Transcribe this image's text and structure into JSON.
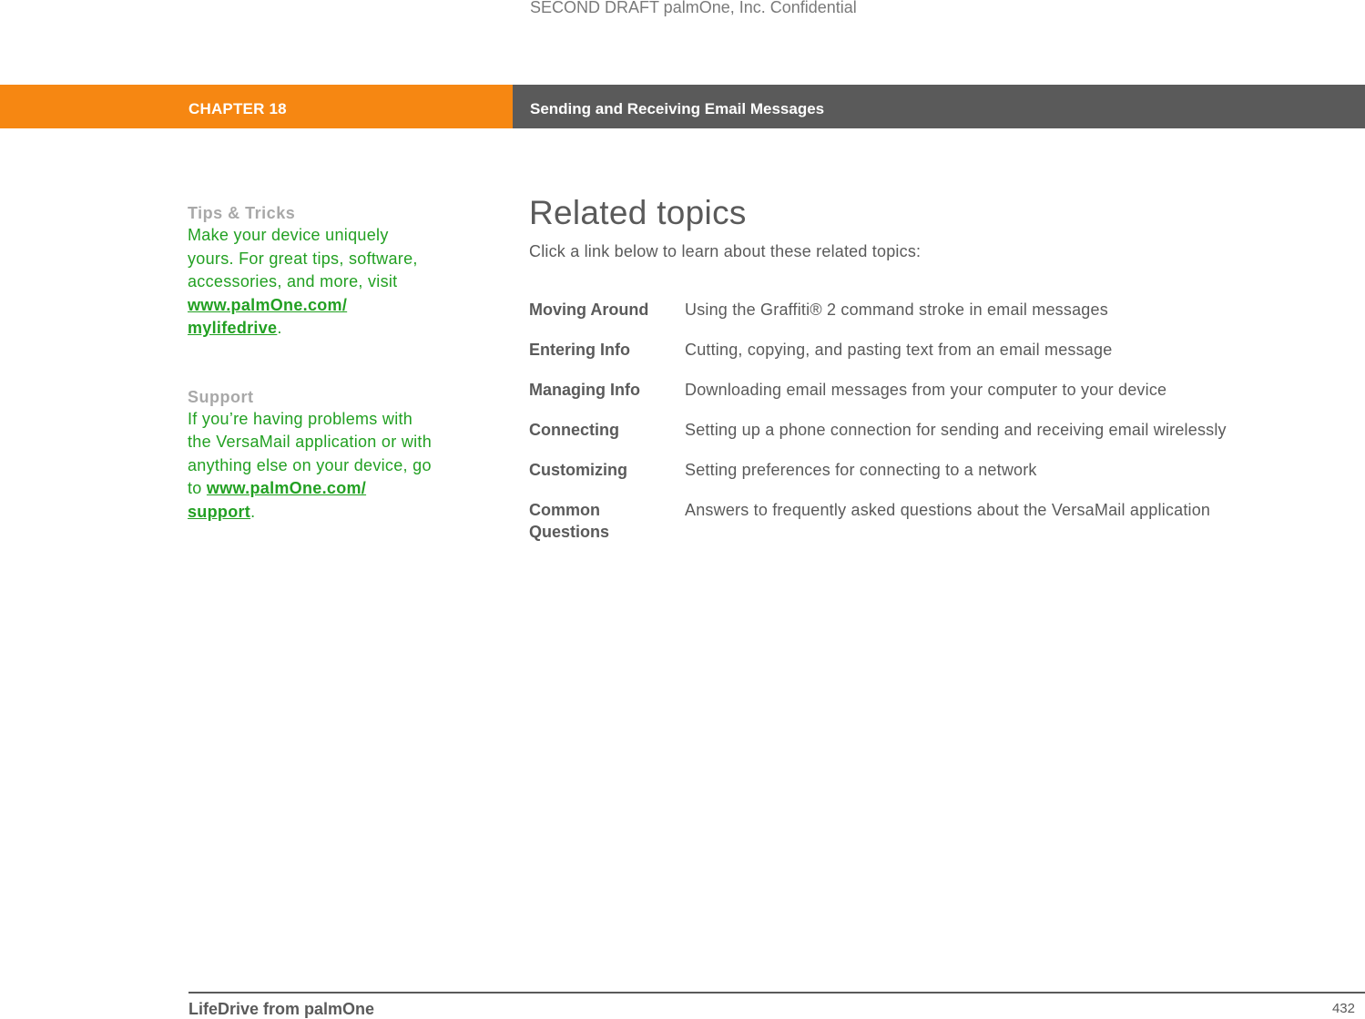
{
  "watermark": "SECOND DRAFT palmOne, Inc.  Confidential",
  "header": {
    "chapter": "CHAPTER 18",
    "title": "Sending and Receiving Email Messages",
    "chapter_color": "#f68712",
    "title_bar_color": "#5a5a5a"
  },
  "sidebar": {
    "tips": {
      "heading": "Tips & Tricks",
      "text": "Make your device uniquely yours. For great tips, software, accessories, and more, visit ",
      "link": "www.palmOne.com/ mylifedrive",
      "suffix": "."
    },
    "support": {
      "heading": "Support",
      "text": "If you’re having problems with the VersaMail application or with anything else on your device, go to ",
      "link": "www.palmOne.com/ support",
      "suffix": "."
    },
    "text_color": "#22a022"
  },
  "main": {
    "title": "Related topics",
    "intro": "Click a link below to learn about these related topics:",
    "topics": [
      {
        "link": "Moving Around",
        "description": "Using the Graffiti® 2 command stroke in email messages"
      },
      {
        "link": "Entering Info",
        "description": "Cutting, copying, and pasting text from an email message"
      },
      {
        "link": "Managing Info",
        "description": "Downloading email messages from your computer to your device"
      },
      {
        "link": "Connecting",
        "description": "Setting up a phone connection for sending and receiving email wirelessly"
      },
      {
        "link": "Customizing",
        "description": "Setting preferences for connecting to a network"
      },
      {
        "link": "Common Questions",
        "description": "Answers to frequently asked questions about the VersaMail application"
      }
    ]
  },
  "footer": {
    "book_title": "LifeDrive from palmOne",
    "page_number": "432"
  }
}
